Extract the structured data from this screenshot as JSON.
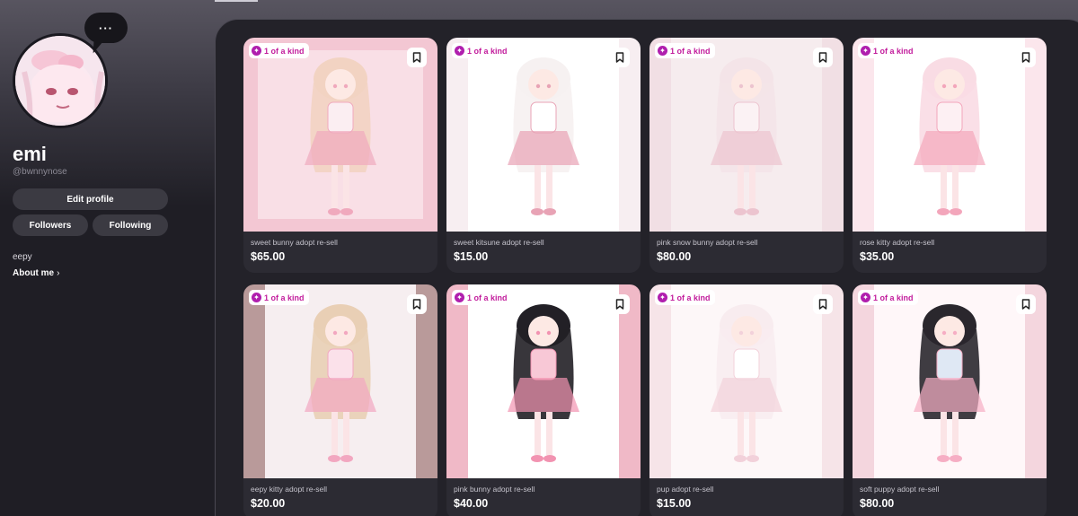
{
  "profile": {
    "more_label": "···",
    "name": "emi",
    "handle": "@bwnnynose",
    "edit_label": "Edit profile",
    "followers_label": "Followers",
    "following_label": "Following",
    "bio": "eepy",
    "about_label": "About me",
    "about_chevron": "›"
  },
  "listings": [
    {
      "badge": "1 of a kind",
      "title": "sweet bunny adopt re-sell",
      "price": "$65.00"
    },
    {
      "badge": "1 of a kind",
      "title": "sweet kitsune adopt re-sell",
      "price": "$15.00"
    },
    {
      "badge": "1 of a kind",
      "title": "pink snow bunny adopt re-sell",
      "price": "$80.00"
    },
    {
      "badge": "1 of a kind",
      "title": "rose kitty adopt re-sell",
      "price": "$35.00"
    },
    {
      "badge": "1 of a kind",
      "title": "eepy kitty adopt re-sell",
      "price": "$20.00"
    },
    {
      "badge": "1 of a kind",
      "title": "pink bunny adopt re-sell",
      "price": "$40.00"
    },
    {
      "badge": "1 of a kind",
      "title": "pup adopt re-sell",
      "price": "$15.00"
    },
    {
      "badge": "1 of a kind",
      "title": "soft puppy adopt re-sell",
      "price": "$80.00"
    }
  ],
  "badge_icon": "sparkle-icon",
  "bookmark_icon": "bookmark-icon",
  "colors": {
    "badge_text": "#c21c9c",
    "badge_icon": "#b01fae",
    "background": "#1f1e25"
  }
}
